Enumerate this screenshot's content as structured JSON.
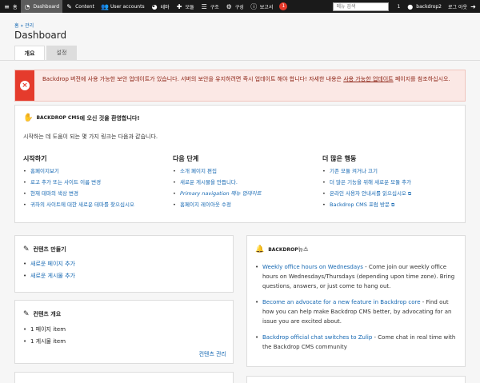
{
  "adminbar": {
    "items": [
      {
        "icon": "menu-icon",
        "glyph": "≡",
        "label": "홈"
      },
      {
        "icon": "dashboard-icon",
        "glyph": "◔",
        "label": "Dashboard",
        "active": true
      },
      {
        "icon": "pencil-icon",
        "glyph": "✎",
        "label": "Content"
      },
      {
        "icon": "users-icon",
        "glyph": "👥",
        "label": "User accounts"
      },
      {
        "icon": "palette-icon",
        "glyph": "◕",
        "label": "테마"
      },
      {
        "icon": "puzzle-icon",
        "glyph": "✚",
        "label": "모듈"
      },
      {
        "icon": "structure-icon",
        "glyph": "☰",
        "label": "구조"
      },
      {
        "icon": "gear-icon",
        "glyph": "⚙",
        "label": "구성"
      },
      {
        "icon": "info-icon",
        "glyph": "ⓘ",
        "label": "보고서"
      }
    ],
    "alert_count": "1",
    "search_placeholder": "메뉴 검색",
    "user_count": "1",
    "username": "backdrop2",
    "logout_label": "로그 아웃"
  },
  "page": {
    "breadcrumb_home": "홈",
    "breadcrumb_sep": "»",
    "breadcrumb_admin": "관리",
    "title": "Dashboard",
    "tabs": [
      {
        "label": "개요",
        "active": true
      },
      {
        "label": "설정",
        "active": false
      }
    ]
  },
  "error": {
    "text_before": "Backdrop 버전에 사용 가능한 보안 업데이트가 있습니다. 서버의 보안을 유지하려면 즉시 업데이트 해야 합니다! 자세한 내용은 ",
    "link_text": "사용 가능한 업데이트",
    "text_after": " 페이지를 참조하십시오."
  },
  "welcome": {
    "title_prefix": "BACKDROP CMS",
    "title_suffix": "에 오신 것을 환영합니다!",
    "description": "시작하는 데 도움이 되는 몇 가지 링크는 다음과 같습니다.",
    "columns": [
      {
        "heading": "시작하기",
        "links": [
          "홈페이지보기",
          "로고 추가 또는 사이트 이름 변경",
          "현재 테마의 색상 변경",
          "귀하의 사이트에 대한 새로운 테마를 찾으십시오"
        ]
      },
      {
        "heading": "다음 단계",
        "links": [
          "소개 페이지 편집",
          "새로운 게시물을 만듭니다.",
          "Primary navigation 메뉴 업데이트",
          "홈페이지 레이아웃 수정"
        ]
      },
      {
        "heading": "더 많은 행동",
        "links": [
          "기존 모듈 켜거나 끄기",
          "더 많은 기능을 위해 새로운 모듈 추가",
          "온라인 사용자 안내서를 읽으십시오",
          "Backdrop CMS 포럼 방문"
        ]
      }
    ],
    "ext_glyph": "⧉"
  },
  "create_content": {
    "title": "컨텐츠 만들기",
    "links": [
      "새로운 페이지 추가",
      "새로운 게시물 추가"
    ]
  },
  "content_overview": {
    "title": "컨텐츠 개요",
    "items": [
      "1 페이지 item",
      "1 게시물 item"
    ],
    "manage_link": "컨텐츠 관리"
  },
  "news": {
    "title_prefix": "BACKDROP",
    "title_suffix": " 뉴스",
    "items": [
      {
        "link": "Weekly office hours on Wednesdays",
        "text": " - Come join our weekly office hours on Wednesdays/Thursdays (depending upon time zone). Bring questions, answers, or just come to hang out."
      },
      {
        "link": "Become an advocate for a new feature in Backdrop core",
        "text": " - Find out how you can help make Backdrop CMS better, by advocating for an issue you are excited about."
      },
      {
        "link": "Backdrop official chat switches to Zulip",
        "text": " - Come chat in real time with the Backdrop CMS community"
      }
    ]
  }
}
